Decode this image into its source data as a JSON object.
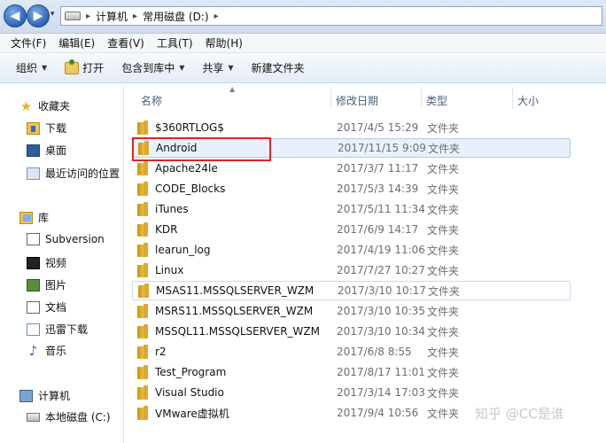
{
  "address": {
    "crumbs": [
      "计算机",
      "常用磁盘 (D:)"
    ]
  },
  "menu": [
    "文件(F)",
    "编辑(E)",
    "查看(V)",
    "工具(T)",
    "帮助(H)"
  ],
  "toolbar": {
    "organize": "组织",
    "open": "打开",
    "include_library": "包含到库中",
    "share": "共享",
    "new_folder": "新建文件夹"
  },
  "sidebar": {
    "favorites": {
      "label": "收藏夹",
      "items": [
        "下载",
        "桌面",
        "最近访问的位置"
      ]
    },
    "libraries": {
      "label": "库",
      "items": [
        "Subversion",
        "视频",
        "图片",
        "文档",
        "迅雷下载",
        "音乐"
      ]
    },
    "computer": {
      "label": "计算机",
      "items": [
        "本地磁盘 (C:)"
      ]
    }
  },
  "columns": {
    "name": "名称",
    "modified": "修改日期",
    "type": "类型",
    "size": "大小"
  },
  "files": [
    {
      "name": "$360RTLOG$",
      "modified": "2017/4/5 15:29",
      "type": "文件夹"
    },
    {
      "name": "Android",
      "modified": "2017/11/15 9:09",
      "type": "文件夹"
    },
    {
      "name": "Apache24le",
      "modified": "2017/3/7 11:17",
      "type": "文件夹"
    },
    {
      "name": "CODE_Blocks",
      "modified": "2017/5/3 14:39",
      "type": "文件夹"
    },
    {
      "name": "iTunes",
      "modified": "2017/5/11 11:34",
      "type": "文件夹"
    },
    {
      "name": "KDR",
      "modified": "2017/6/9 14:17",
      "type": "文件夹"
    },
    {
      "name": "learun_log",
      "modified": "2017/4/19 11:06",
      "type": "文件夹"
    },
    {
      "name": "Linux",
      "modified": "2017/7/27 10:27",
      "type": "文件夹"
    },
    {
      "name": "MSAS11.MSSQLSERVER_WZM",
      "modified": "2017/3/10 10:17",
      "type": "文件夹"
    },
    {
      "name": "MSRS11.MSSQLSERVER_WZM",
      "modified": "2017/3/10 10:35",
      "type": "文件夹"
    },
    {
      "name": "MSSQL11.MSSQLSERVER_WZM",
      "modified": "2017/3/10 10:34",
      "type": "文件夹"
    },
    {
      "name": "r2",
      "modified": "2017/6/8 8:55",
      "type": "文件夹"
    },
    {
      "name": "Test_Program",
      "modified": "2017/8/17 11:01",
      "type": "文件夹"
    },
    {
      "name": "Visual Studio",
      "modified": "2017/3/14 17:03",
      "type": "文件夹"
    },
    {
      "name": "VMware虚拟机",
      "modified": "2017/9/4 10:56",
      "type": "文件夹"
    }
  ],
  "watermark": "知乎 @CC是谁"
}
